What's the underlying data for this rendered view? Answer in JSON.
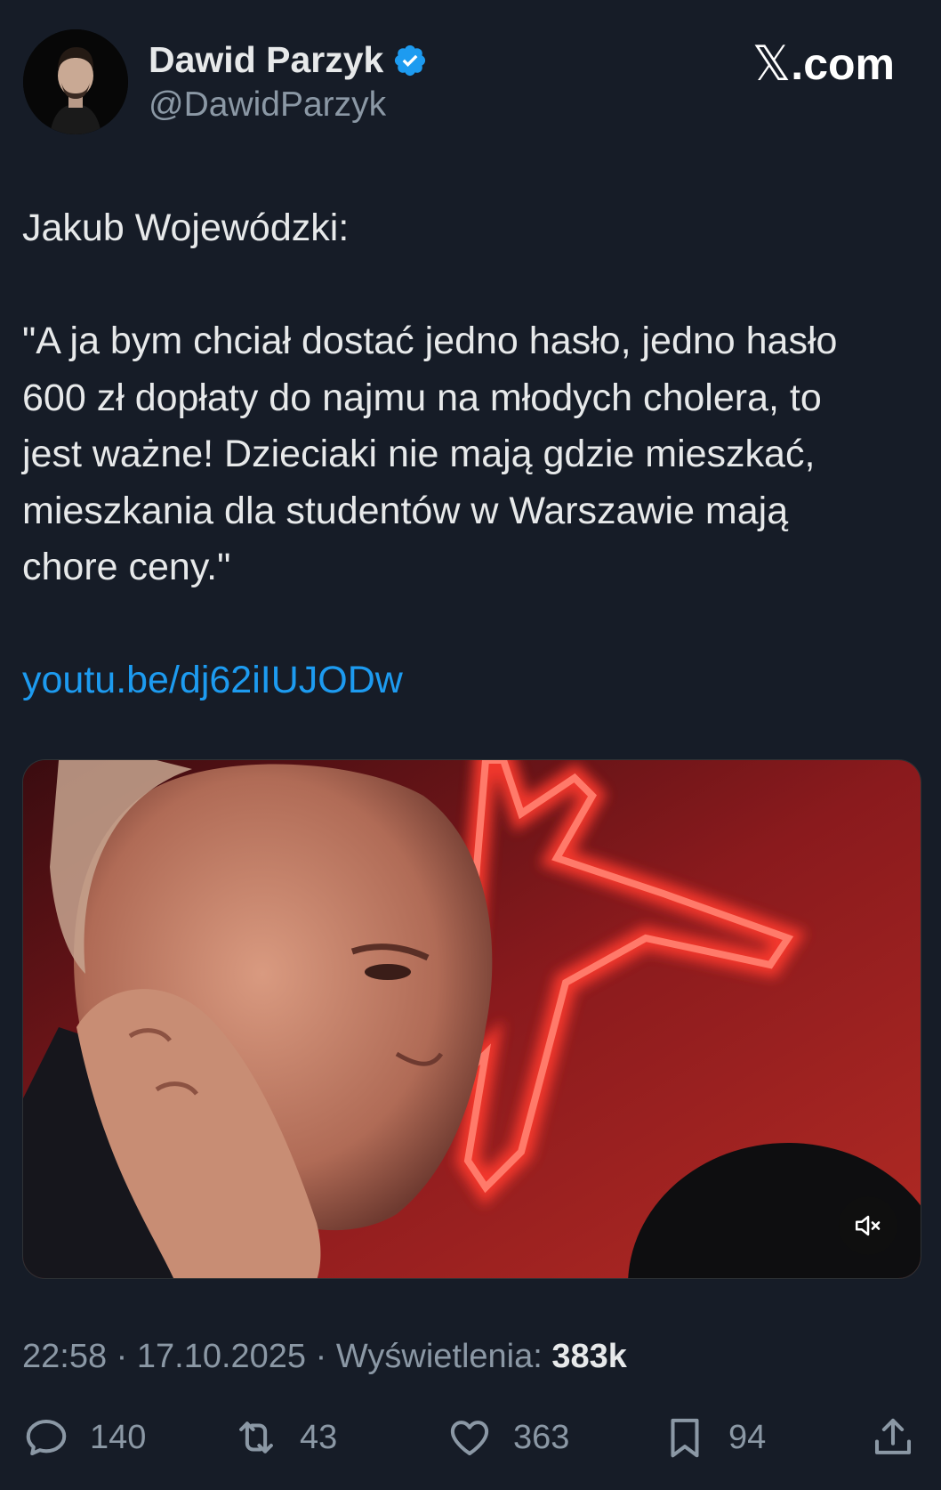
{
  "author": {
    "name": "Dawid Parzyk",
    "handle": "@DawidParzyk",
    "verified": true
  },
  "brand": {
    "logo_glyph": "𝕏",
    "domain": ".com"
  },
  "tweet": {
    "line1": "Jakub Wojewódzki:",
    "quote_lines": [
      "\"A ja bym chciał dostać jedno hasło, jedno hasło",
      "600 zł dopłaty do najmu na młodych cholera, to",
      "jest ważne! Dzieciaki nie mają gdzie mieszkać,",
      "mieszkania dla studentów w Warszawie mają",
      "chore ceny.\""
    ],
    "link": "youtu.be/dj62iIUJODw"
  },
  "media": {
    "type": "video",
    "muted": true,
    "mute_icon": "speaker-muted-icon"
  },
  "meta": {
    "time": "22:58",
    "separator": " · ",
    "date": "17.10.2025",
    "views_label": "Wyświetlenia: ",
    "views_count": "383k"
  },
  "actions": {
    "replies": "140",
    "reposts": "43",
    "likes": "363",
    "bookmarks": "94"
  },
  "colors": {
    "background": "#161c27",
    "text": "#e7e9ea",
    "secondary": "#8b98a5",
    "link": "#1d9bf0",
    "verified": "#1d9bf0"
  }
}
